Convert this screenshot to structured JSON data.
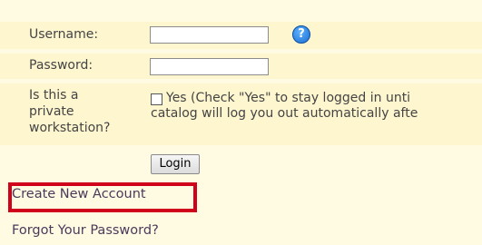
{
  "form": {
    "username_label": "Username:",
    "password_label": "Password:",
    "private_label_line1": "Is this a",
    "private_label_line2": "private",
    "private_label_line3": "workstation?",
    "username_value": "",
    "password_value": "",
    "private_checkbox_checked": false,
    "private_option_text": "Yes  (Check \"Yes\" to stay logged in unti",
    "private_note_line2": "catalog will log you out automatically afte",
    "help_icon": "question-circle-icon",
    "login_label": "Login"
  },
  "links": {
    "create_account": "Create New Account",
    "forgot_password": "Forgot Your Password?"
  },
  "colors": {
    "background": "#fffbe3",
    "row_background": "#fef6cf",
    "highlight_border": "#d0021b",
    "help_icon_blue": "#1a6fd1"
  }
}
